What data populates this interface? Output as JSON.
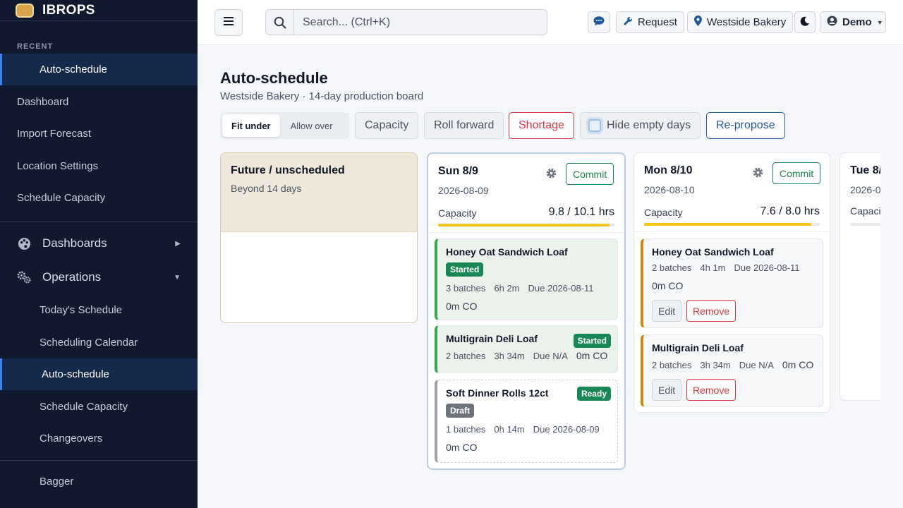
{
  "app": {
    "name": "IBROPS"
  },
  "sidebar": {
    "recent_heading": "RECENT",
    "recent_item": "Auto-schedule",
    "items": [
      "Dashboard",
      "Import Forecast",
      "Location Settings",
      "Schedule Capacity"
    ],
    "groups": {
      "dashboards": "Dashboards",
      "operations": "Operations"
    },
    "operations_items": [
      "Today's Schedule",
      "Scheduling Calendar",
      "Auto-schedule",
      "Schedule Capacity",
      "Changeovers"
    ],
    "bottom_item": "Bagger"
  },
  "topbar": {
    "search_placeholder": "Search... (Ctrl+K)",
    "request_label": "Request",
    "location_label": "Westside Bakery",
    "user_label": "Demo"
  },
  "page": {
    "title": "Auto-schedule",
    "subtitle": "Westside Bakery · 14-day production board"
  },
  "toolbar": {
    "fit_under": "Fit under",
    "allow_over": "Allow over",
    "capacity": "Capacity",
    "roll_forward": "Roll forward",
    "shortage": "Shortage",
    "hide_empty": "Hide empty days",
    "repropose": "Re-propose"
  },
  "future": {
    "title": "Future / unscheduled",
    "subtitle": "Beyond 14 days"
  },
  "days": [
    {
      "title": "Sun 8/9",
      "date": "2026-08-09",
      "commit": "Commit",
      "capacity_label": "Capacity",
      "capacity_value": "9.8 / 10.1 hrs",
      "capacity_fraction": 0.97,
      "cards": [
        {
          "title": "Honey Oat Sandwich Loaf",
          "badge": "Started",
          "batches": "3 batches",
          "time": "6h 2m",
          "due": "Due 2026-08-11",
          "co": "0m CO"
        },
        {
          "title": "Multigrain Deli Loaf",
          "badge": "Started",
          "batches": "2 batches",
          "time": "3h 34m",
          "due": "Due N/A",
          "co": "0m CO"
        },
        {
          "title": "Soft Dinner Rolls 12ct",
          "badge": "Ready",
          "badge2": "Draft",
          "batches": "1 batches",
          "time": "0h 14m",
          "due": "Due 2026-08-09",
          "co": "0m CO"
        }
      ]
    },
    {
      "title": "Mon 8/10",
      "date": "2026-08-10",
      "commit": "Commit",
      "capacity_label": "Capacity",
      "capacity_value": "7.6 / 8.0 hrs",
      "capacity_fraction": 0.95,
      "cards": [
        {
          "title": "Honey Oat Sandwich Loaf",
          "batches": "2 batches",
          "time": "4h 1m",
          "due": "Due 2026-08-11",
          "co": "0m CO",
          "edit": "Edit",
          "remove": "Remove"
        },
        {
          "title": "Multigrain Deli Loaf",
          "batches": "2 batches",
          "time": "3h 34m",
          "due": "Due N/A",
          "co": "0m CO",
          "edit": "Edit",
          "remove": "Remove"
        }
      ]
    },
    {
      "title": "Tue 8/",
      "date": "2026-0",
      "capacity_label": "Capaci"
    }
  ]
}
